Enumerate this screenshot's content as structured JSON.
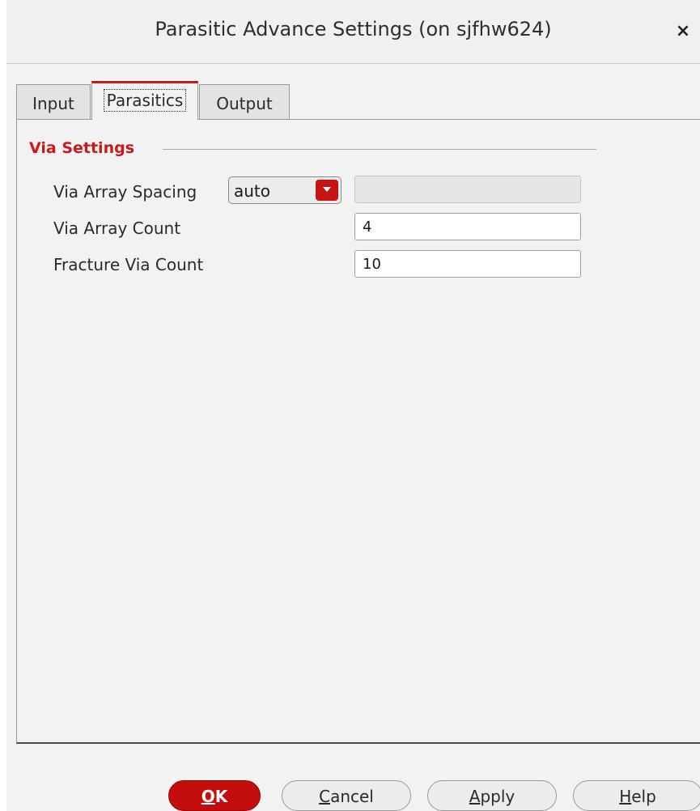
{
  "window": {
    "title": "Parasitic Advance Settings (on sjfhw624)",
    "close_label": "×"
  },
  "tabs": [
    {
      "label": "Input"
    },
    {
      "label": "Parasitics",
      "active": true
    },
    {
      "label": "Output"
    }
  ],
  "section": {
    "title": "Via Settings"
  },
  "fields": {
    "via_array_spacing": {
      "label": "Via Array Spacing",
      "selected": "auto",
      "value": ""
    },
    "via_array_count": {
      "label": "Via Array Count",
      "value": "4"
    },
    "fracture_via_count": {
      "label": "Fracture Via Count",
      "value": "10"
    }
  },
  "buttons": {
    "ok": {
      "mnemonic": "O",
      "rest": "K"
    },
    "cancel": {
      "mnemonic": "C",
      "rest": "ancel"
    },
    "apply": {
      "mnemonic": "A",
      "rest": "pply"
    },
    "help": {
      "mnemonic": "H",
      "rest": "elp"
    }
  },
  "colors": {
    "accent": "#c81a1a",
    "panel_bg": "#f2f2f2"
  }
}
